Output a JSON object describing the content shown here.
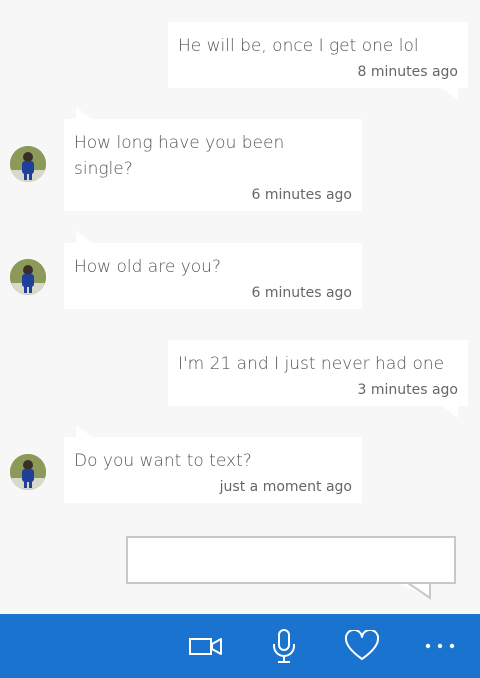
{
  "messages": [
    {
      "direction": "outgoing",
      "text": "He will be, once I get one lol",
      "time": "8 minutes ago"
    },
    {
      "direction": "incoming",
      "text": "How long have you been single?",
      "time": "6 minutes ago"
    },
    {
      "direction": "incoming",
      "text": "How old are you?",
      "time": "6 minutes ago"
    },
    {
      "direction": "outgoing",
      "text": "I'm 21 and I just never had one",
      "time": "3 minutes ago"
    },
    {
      "direction": "incoming",
      "text": "Do you want to text?",
      "time": "just a moment ago"
    }
  ],
  "composer": {
    "value": "",
    "placeholder": ""
  },
  "appbar": {
    "icons": [
      "video-call-icon",
      "microphone-icon",
      "heart-icon",
      "more-options-icon"
    ],
    "background": "#1a74cf"
  },
  "colors": {
    "background": "#f7f7f7",
    "bubble": "#ffffff",
    "text": "#555555",
    "accent": "#1a74cf"
  }
}
